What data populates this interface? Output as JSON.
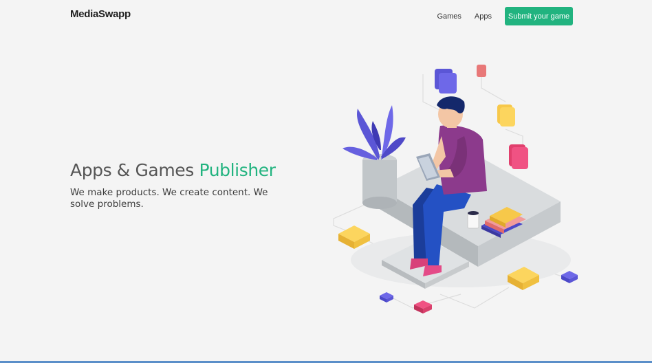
{
  "header": {
    "logo_text": "MediaSwapp",
    "nav": [
      "Games",
      "Apps"
    ],
    "cta_label": "Submit your game"
  },
  "hero": {
    "title_main": "Apps & Games ",
    "title_accent": "Publisher",
    "subtitle": "We make products. We create content. We solve problems."
  },
  "colors": {
    "accent": "#21b37f",
    "background": "#f4f4f4",
    "text": "#555555"
  },
  "illustration": {
    "subject": "person-with-tablet-icon"
  }
}
